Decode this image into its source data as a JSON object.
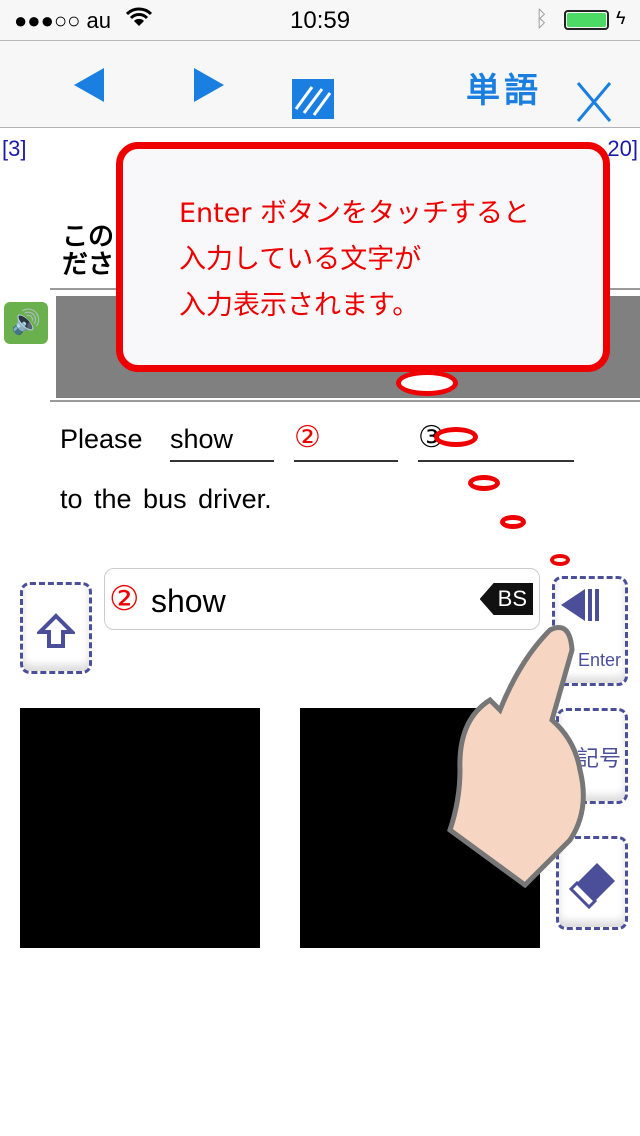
{
  "status": {
    "carrier": "●●●○○ au",
    "time": "10:59",
    "battery_color": "#4cd964"
  },
  "navbar": {
    "prev_icon": "triangle-left",
    "next_icon": "triangle-right",
    "pattern_icon": "hatched-square",
    "word_label": "単語",
    "close_icon": "x"
  },
  "counter": {
    "left": "[3]",
    "right": "20]"
  },
  "question": {
    "line1": "この",
    "line2": "ださ"
  },
  "sentence": {
    "word1": "Please",
    "blank1": "show",
    "blank2": "②",
    "blank3": "③",
    "line2": "to the bus driver."
  },
  "input": {
    "marker": "②",
    "value": "show",
    "bs_label": "BS"
  },
  "keys": {
    "shift_icon": "arrow-up",
    "enter_label": "Enter",
    "symbol_label": "記号",
    "eraser_icon": "eraser"
  },
  "tooltip": {
    "line1": "Enter ボタンをタッチすると",
    "line2": "入力している文字が",
    "line3": "入力表示されます。"
  },
  "colors": {
    "accent": "#1a7fe0",
    "tooltip_border": "#ee0000",
    "key_border": "#4b4f9a"
  }
}
